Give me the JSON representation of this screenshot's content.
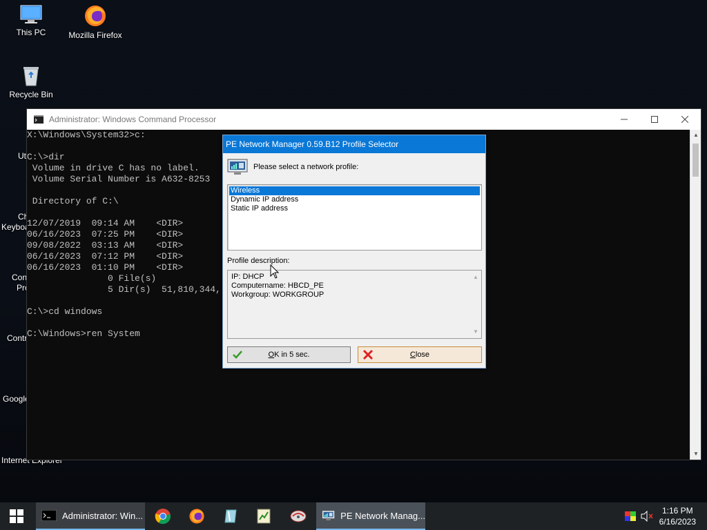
{
  "desktop": {
    "icons": [
      {
        "label": "This PC"
      },
      {
        "label": "Mozilla Firefox"
      },
      {
        "label": "Recycle Bin"
      }
    ],
    "partial_labels": [
      "Ut",
      "Ch",
      "Keyboa",
      "Con",
      "Pro",
      "Contr",
      "Google",
      "Internet Explorer"
    ]
  },
  "cmd": {
    "title": "Administrator: Windows Command Processor",
    "lines": [
      "X:\\Windows\\System32>c:",
      "",
      "C:\\>dir",
      " Volume in drive C has no label.",
      " Volume Serial Number is A632-8253",
      "",
      " Directory of C:\\",
      "",
      "12/07/2019  09:14 AM    <DIR>",
      "06/16/2023  07:25 PM    <DIR>",
      "09/08/2022  03:13 AM    <DIR>",
      "06/16/2023  07:12 PM    <DIR>",
      "06/16/2023  01:10 PM    <DIR>",
      "               0 File(s)",
      "               5 Dir(s)  51,810,344,",
      "",
      "C:\\>cd windows",
      "",
      "C:\\Windows>ren System"
    ]
  },
  "dialog": {
    "title": "PE Network Manager 0.59.B12 Profile Selector",
    "prompt": "Please select a network profile:",
    "profiles": [
      "Wireless",
      "Dynamic IP address",
      "Static IP address"
    ],
    "selected_index": 0,
    "description_label": "Profile description:",
    "description_lines": [
      "IP: DHCP",
      "Computername: HBCD_PE",
      "Workgroup: WORKGROUP"
    ],
    "ok_label": "OK in 5 sec.",
    "close_label": "Close"
  },
  "taskbar": {
    "windows": [
      {
        "label": "Administrator: Win..."
      },
      {
        "label": "PE Network Manag..."
      }
    ],
    "time": "1:16 PM",
    "date": "6/16/2023"
  }
}
